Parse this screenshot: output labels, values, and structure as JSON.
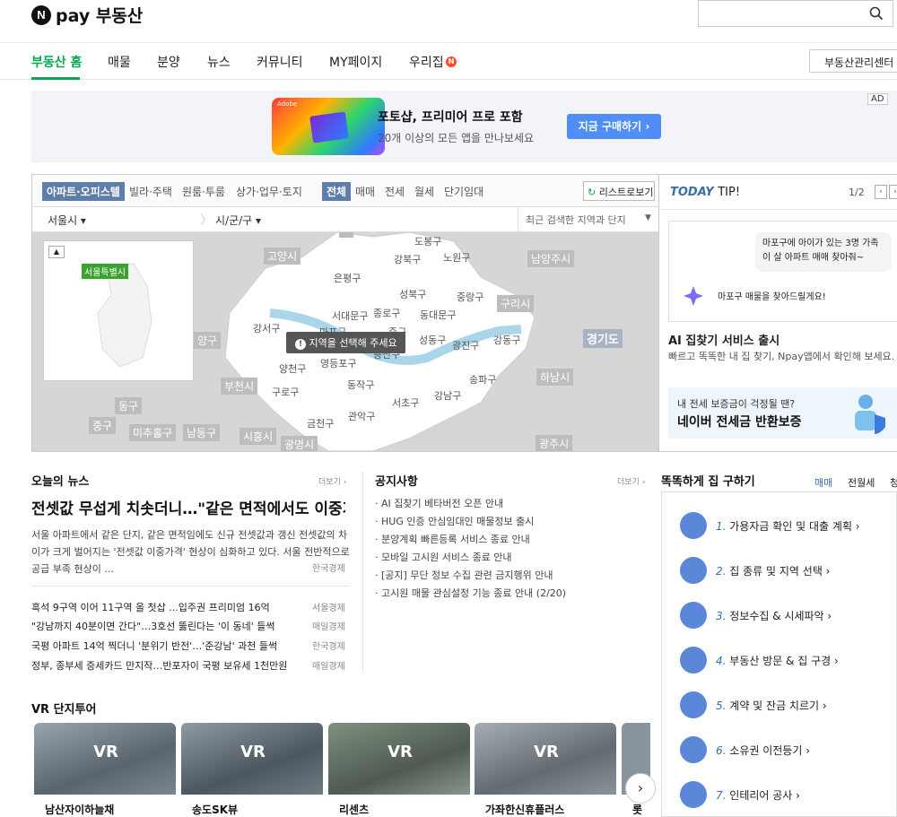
{
  "header": {
    "logo_letter": "N",
    "brand": "pay 부동산"
  },
  "nav": {
    "items": [
      "부동산 홈",
      "매물",
      "분양",
      "뉴스",
      "커뮤니티",
      "MY페이지",
      "우리집"
    ],
    "badge": "N",
    "mgmt_button": "부동산관리센터"
  },
  "ad": {
    "brand": "Adobe",
    "title": "포토샵, 프리미어 프로 포함",
    "subtitle": "20개 이상의 모든 앱을 만나보세요",
    "button": "지금 구매하기 ›",
    "ad_mark": "AD"
  },
  "map_panel": {
    "property_tabs": [
      "아파트·오피스텔",
      "빌라·주택",
      "원룸·투룸",
      "상가·업무·토지"
    ],
    "deal_tabs": [
      "전체",
      "매매",
      "전세",
      "월세",
      "단기임대"
    ],
    "list_button": "리스트로보기",
    "region1": "서울시 ▾",
    "region2": "시/군/구 ▾",
    "recent": "최근 검색한 지역과 단지",
    "mini_label": "서울특별시",
    "tooltip": "지역을 선택해 주세요",
    "districts": [
      "도봉구",
      "노원구",
      "강북구",
      "은평구",
      "성북구",
      "중랑구",
      "종로구",
      "동대문구",
      "서대문구",
      "마포구",
      "중구",
      "강서구",
      "용산구",
      "성동구",
      "광진구",
      "강동구",
      "양천구",
      "영등포구",
      "동작구",
      "구로구",
      "서초구",
      "강남구",
      "송파구",
      "관악구",
      "금천구"
    ],
    "cities": [
      "고양시",
      "남양주시",
      "구리시",
      "경기도",
      "하남시",
      "양구",
      "부천시",
      "동구",
      "중구",
      "미추홀구",
      "남동구",
      "시흥시",
      "광명시",
      "광주시"
    ]
  },
  "tip": {
    "today": "TODAY",
    "tip_word": "TIP!",
    "page": "1/2",
    "bubble": "마포구에 아이가 있는 3명 가족이 살 아파트 매매 찾아줘~",
    "ai_reply": "마포구 매물을 찾아드릴게요!",
    "service_title": "AI 집찾기 서비스 출시",
    "service_desc": "빠르고 똑똑한 내 집 찾기, Npay앱에서 확인해 보세요.",
    "guarantee_q": "내 전세 보증금이 걱정될 땐?",
    "guarantee_title": "네이버 전세금 반환보증"
  },
  "news": {
    "title": "오늘의 뉴스",
    "more": "더보기 ›",
    "headline": "전셋값 무섭게 치솟더니…\"같은 면적에서도 이중가격\"",
    "summary": "서울 아파트에서 같은 단지, 같은 면적임에도 신규 전셋값과 갱신 전셋값의 차이가 크게 벌어지는 '전셋값 이중가격' 현상이 심화하고 있다. 서울 전반적으로 공급 부족 현상이 ...",
    "summary_source": "한국경제",
    "items": [
      {
        "title": "흑석 9구역 이어 11구역 올 첫삽 ...입주권 프리미엄 16억",
        "source": "서울경제"
      },
      {
        "title": "\"강남까지 40분이면 간다\"…3호선 뚫린다는 '이 동네' 들썩",
        "source": "매일경제"
      },
      {
        "title": "국평 아파트 14억 찍더니 '분위기 반전'…'준강남' 과천 들썩",
        "source": "한국경제"
      },
      {
        "title": "정부, 종부세 증세카드 만지작…반포자이 국평 보유세 1천만원",
        "source": "매일경제"
      }
    ]
  },
  "notices": {
    "title": "공지사항",
    "more": "더보기 ›",
    "items": [
      "AI 집찾기 베타버전 오픈 안내",
      "HUG 인증 안심임대인 매물정보 출시",
      "분양계획 빠른등록 서비스 종료 안내",
      "모바일 고시원 서비스 종료 안내",
      "[공지] 무단 정보 수집 관련 금지행위 안내",
      "고시원 매물 관심설정 기능 종료 안내 (2/20)"
    ]
  },
  "home_guide": {
    "title": "똑똑하게 집 구하기",
    "tabs": [
      "매매",
      "전월세",
      "청"
    ],
    "steps": [
      {
        "num": "1.",
        "label": "가용자금 확인 및 대출 계획 ›"
      },
      {
        "num": "2.",
        "label": "집 종류 및 지역 선택 ›"
      },
      {
        "num": "3.",
        "label": "정보수집 & 시세파악 ›"
      },
      {
        "num": "4.",
        "label": "부동산 방문 & 집 구경 ›"
      },
      {
        "num": "5.",
        "label": "계약 및 잔금 치르기 ›"
      },
      {
        "num": "6.",
        "label": "소유권 이전등기 ›"
      },
      {
        "num": "7.",
        "label": "인테리어 공사 ›"
      }
    ]
  },
  "vr": {
    "title": "VR 단지투어",
    "badge": "VR",
    "items": [
      "남산자이하늘채",
      "송도SK뷰",
      "리센츠",
      "가좌한신휴플러스",
      "롯데"
    ]
  },
  "colors": {
    "accent": "#03a94d",
    "primary_blue": "#4f8ef7",
    "tab_blue": "#5e7da8"
  }
}
